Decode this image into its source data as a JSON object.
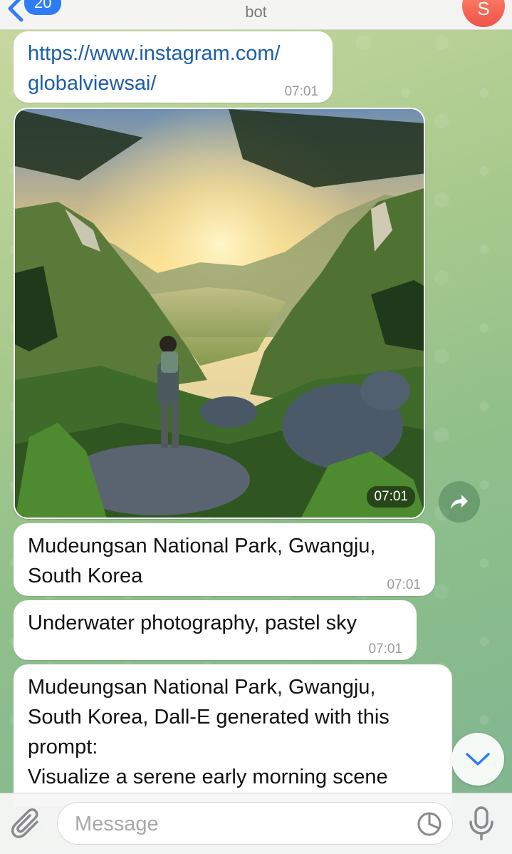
{
  "header": {
    "back_count": "20",
    "title": "bot",
    "avatar_letter": "S"
  },
  "messages": [
    {
      "type": "link",
      "line1": "https://www.instagram.com/",
      "line2": "globalviewsai/",
      "time": "07:01"
    },
    {
      "type": "photo",
      "time": "07:01"
    },
    {
      "type": "text",
      "line1": "Mudeungsan National Park, Gwangju,",
      "line2": "South Korea",
      "time": "07:01"
    },
    {
      "type": "text",
      "line1": "Underwater photography, pastel sky",
      "time": "07:01"
    },
    {
      "type": "text",
      "line1": "Mudeungsan National Park, Gwangju,",
      "line2": "South Korea, Dall-E generated with this",
      "line3": "prompt:",
      "line4": "Visualize a serene early morning scene"
    }
  ],
  "composer": {
    "placeholder": "Message"
  },
  "colors": {
    "accent": "#2f7cf6",
    "link": "#1c5ea8",
    "avatar": "#f0524a"
  }
}
